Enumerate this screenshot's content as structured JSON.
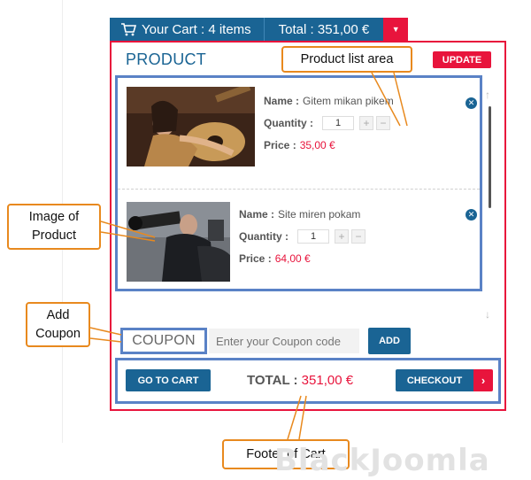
{
  "header": {
    "cart_label": "Your Cart : 4 items",
    "total_label": "Total : 351,00 €",
    "toggle_icon": "▼"
  },
  "cart": {
    "title": "PRODUCT",
    "update_label": "UPDATE",
    "items": [
      {
        "name_label": "Name :",
        "name": "Gitem mikan pikem",
        "quantity_label": "Quantity :",
        "quantity": "1",
        "price_label": "Price :",
        "price": "35,00 €"
      },
      {
        "name_label": "Name :",
        "name": "Site miren pokam",
        "quantity_label": "Quantity :",
        "quantity": "1",
        "price_label": "Price :",
        "price": "64,00 €"
      }
    ],
    "coupon": {
      "label": "COUPON",
      "placeholder": "Enter your Coupon code",
      "add_label": "ADD"
    },
    "footer": {
      "goto_label": "GO TO CART",
      "total_label": "TOTAL :",
      "total_value": "351,00 €",
      "checkout_label": "CHECKOUT",
      "checkout_arrow": "›"
    }
  },
  "callouts": {
    "product_list": "Product list area",
    "image": "Image of Product",
    "coupon": "Add Coupon",
    "footer": "Footer of Cart"
  },
  "watermark": "BlackJoomla",
  "colors": {
    "accent_blue": "#1a6494",
    "accent_red": "#e8143c",
    "highlight_blue": "#5a82c6",
    "callout_orange": "#e8891e"
  }
}
